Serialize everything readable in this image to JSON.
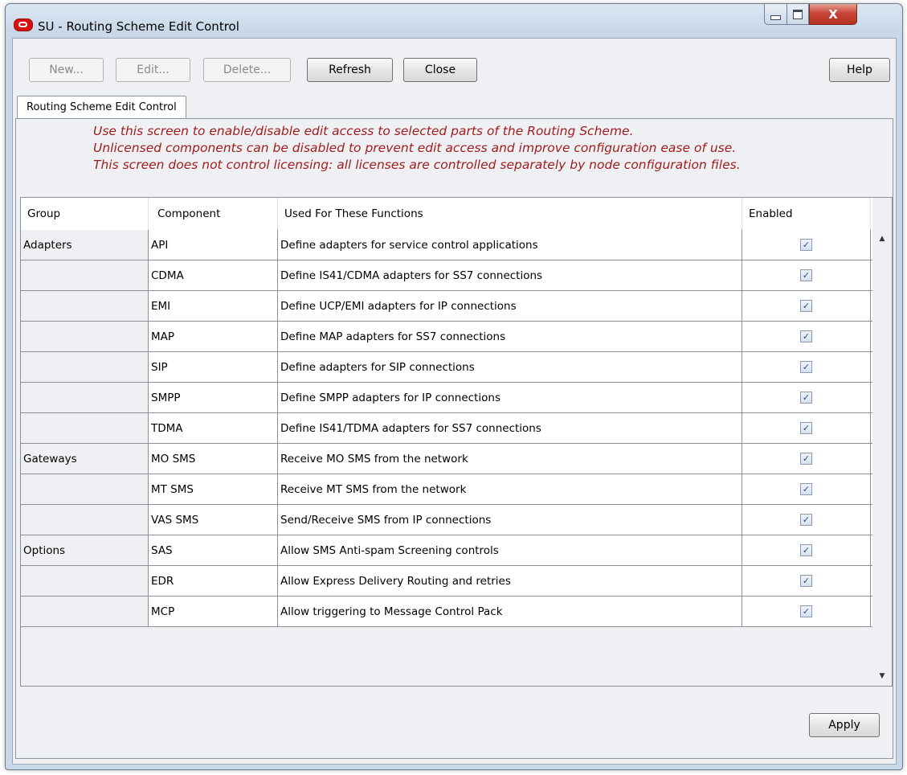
{
  "window": {
    "title": "SU - Routing Scheme Edit Control",
    "controls": {
      "minimize": "minimize",
      "maximize": "maximize",
      "close": "X"
    }
  },
  "toolbar": {
    "new_label": "New...",
    "edit_label": "Edit...",
    "delete_label": "Delete...",
    "refresh_label": "Refresh",
    "close_label": "Close",
    "help_label": "Help"
  },
  "tab": {
    "label": "Routing Scheme Edit Control"
  },
  "notes": [
    "Use this screen to enable/disable edit access to selected parts of the Routing Scheme.",
    "Unlicensed components can be disabled to prevent edit access and improve configuration ease of use.",
    "This screen does not control licensing: all licenses are controlled separately by node configuration files."
  ],
  "table": {
    "headers": {
      "group": "Group",
      "component": "Component",
      "functions": "Used For These Functions",
      "enabled": "Enabled"
    },
    "rows": [
      {
        "group": "Adapters",
        "component": "API",
        "functions": "Define adapters for service control applications",
        "enabled": true
      },
      {
        "group": "",
        "component": "CDMA",
        "functions": "Define IS41/CDMA adapters for SS7 connections",
        "enabled": true
      },
      {
        "group": "",
        "component": "EMI",
        "functions": "Define UCP/EMI adapters for IP connections",
        "enabled": true
      },
      {
        "group": "",
        "component": "MAP",
        "functions": "Define MAP adapters for SS7 connections",
        "enabled": true
      },
      {
        "group": "",
        "component": "SIP",
        "functions": "Define adapters for SIP connections",
        "enabled": true
      },
      {
        "group": "",
        "component": "SMPP",
        "functions": "Define SMPP adapters for IP connections",
        "enabled": true
      },
      {
        "group": "",
        "component": "TDMA",
        "functions": "Define IS41/TDMA adapters for SS7 connections",
        "enabled": true
      },
      {
        "group": "Gateways",
        "component": "MO SMS",
        "functions": "Receive MO SMS from the network",
        "enabled": true
      },
      {
        "group": "",
        "component": "MT SMS",
        "functions": "Receive MT SMS from the network",
        "enabled": true
      },
      {
        "group": "",
        "component": "VAS SMS",
        "functions": "Send/Receive SMS from IP connections",
        "enabled": true
      },
      {
        "group": "Options",
        "component": "SAS",
        "functions": "Allow SMS Anti-spam Screening controls",
        "enabled": true
      },
      {
        "group": "",
        "component": "EDR",
        "functions": "Allow Express Delivery Routing and retries",
        "enabled": true
      },
      {
        "group": "",
        "component": "MCP",
        "functions": "Allow triggering to Message Control Pack",
        "enabled": true
      }
    ]
  },
  "footer": {
    "apply_label": "Apply"
  },
  "colors": {
    "note_text": "#a11d1d",
    "close_button": "#c7463a",
    "app_icon": "#d8110d"
  }
}
